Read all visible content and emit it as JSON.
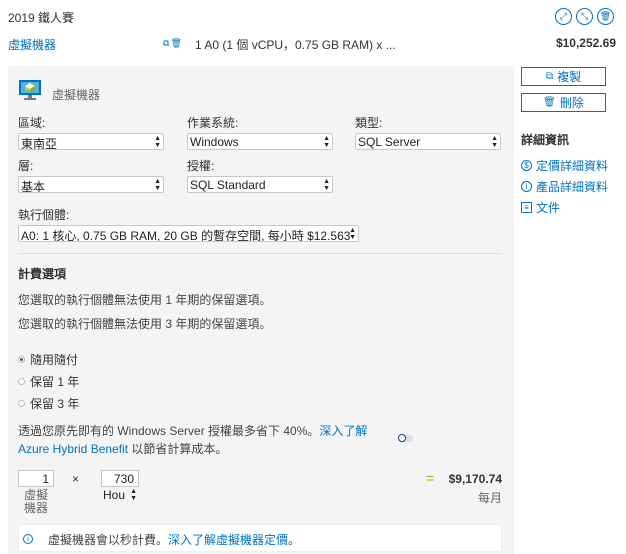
{
  "header": {
    "title": "2019 鐵人賽",
    "icons": [
      "expand-icon",
      "collapse-icon",
      "delete-icon"
    ]
  },
  "estimate_row": {
    "service_name": "虛擬機器",
    "summary": "1 A0 (1 個 vCPU，0.75 GB RAM) x ...",
    "total": "$10,252.69"
  },
  "panel": {
    "title": "虛擬機器",
    "region": {
      "label": "區域:",
      "value": "東南亞"
    },
    "os": {
      "label": "作業系統:",
      "value": "Windows"
    },
    "type": {
      "label": "類型:",
      "value": "SQL Server"
    },
    "tier": {
      "label": "層:",
      "value": "基本"
    },
    "license": {
      "label": "授權:",
      "value": "SQL Standard"
    },
    "instance": {
      "label": "執行個體:",
      "value": "A0: 1 核心, 0.75 GB RAM, 20 GB 的暫存空間, 每小時 $12.563"
    },
    "billing": {
      "title": "計費選項",
      "note1": "您選取的執行個體無法使用 1 年期的保留選項。",
      "note2": "您選取的執行個體無法使用 3 年期的保留選項。",
      "options": [
        {
          "label": "隨用隨付",
          "selected": true
        },
        {
          "label": "保留 1 年",
          "selected": false
        },
        {
          "label": "保留 3 年",
          "selected": false
        }
      ]
    },
    "hybrid": {
      "text": "透過您原先即有的 Windows Server 授權最多省下 40%。",
      "link1": "深入了解",
      "link2": "Azure Hybrid Benefit",
      "text2": "以節省計算成本。",
      "enabled": false
    },
    "calc": {
      "count": "1",
      "count_unit_line1": "虛擬",
      "count_unit_line2": "機器",
      "times": "×",
      "hours": "730",
      "hours_unit": "Hou",
      "equals": "=",
      "price": "$9,170.74",
      "period": "每月"
    },
    "info": {
      "text": "虛擬機器會以秒計費。",
      "link": "深入了解虛擬機器定價",
      "suffix": "。"
    }
  },
  "side": {
    "copy_label": "複製",
    "delete_label": "刪除",
    "details_title": "詳細資訊",
    "links": [
      "定價詳細資料",
      "產品詳細資料",
      "文件"
    ]
  },
  "colors": {
    "accent": "#0072c6",
    "equals": "#7fba00",
    "panel_bg": "#f4f4f4"
  }
}
